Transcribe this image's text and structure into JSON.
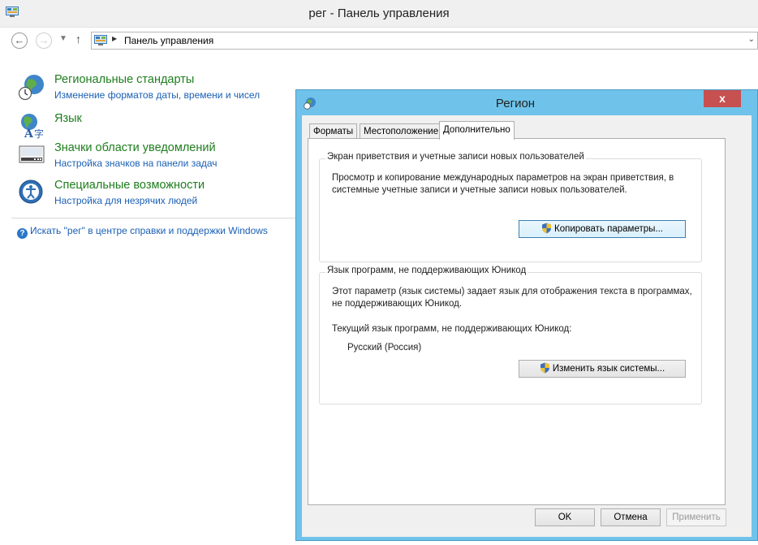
{
  "window": {
    "title": "рег - Панель управления",
    "address": {
      "crumb": "Панель управления"
    }
  },
  "results": [
    {
      "heading": "Региональные стандарты",
      "link": "Изменение форматов даты, времени и чисел",
      "icon": "globe-clock-icon"
    },
    {
      "heading": "Язык",
      "link": "",
      "icon": "language-icon"
    },
    {
      "heading": "Значки области уведомлений",
      "link": "Настройка значков на панели задач",
      "icon": "taskbar-icon"
    },
    {
      "heading": "Специальные возможности",
      "link": "Настройка для незрячих людей",
      "icon": "accessibility-icon"
    }
  ],
  "help_link": "Искать \"рег\" в центре справки и поддержки Windows",
  "dialog": {
    "title": "Регион",
    "close": "x",
    "tabs": [
      "Форматы",
      "Местоположение",
      "Дополнительно"
    ],
    "active_tab": "Дополнительно",
    "welcome_group": {
      "legend": "Экран приветствия и учетные записи новых пользователей",
      "description": "Просмотр и копирование международных параметров на экран приветствия, в системные учетные записи и учетные записи новых пользователей.",
      "button": "Копировать параметры..."
    },
    "unicode_group": {
      "legend": "Язык программ, не поддерживающих Юникод",
      "description": "Этот параметр (язык системы) задает язык для отображения текста в программах, не поддерживающих Юникод.",
      "current_label": "Текущий язык программ, не поддерживающих Юникод:",
      "current_value": "Русский (Россия)",
      "button": "Изменить язык системы..."
    },
    "buttons": {
      "ok": "OK",
      "cancel": "Отмена",
      "apply": "Применить"
    }
  },
  "colors": {
    "dialog_frame": "#6fc3ea",
    "close_button": "#c75050",
    "link": "#1a5fb4",
    "heading": "#1e7d1e"
  }
}
